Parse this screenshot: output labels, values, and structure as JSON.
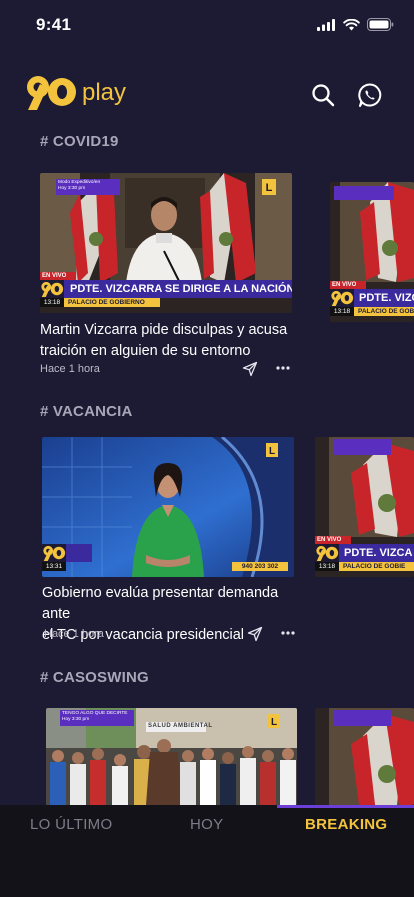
{
  "status_bar": {
    "time": "9:41"
  },
  "header": {
    "logo_word": "play",
    "search_icon": "search-icon",
    "whatsapp_icon": "whatsapp-icon"
  },
  "sections": [
    {
      "tag": "# COVID19",
      "card": {
        "title_line1": "Martin Vizcarra pide disculpas y acusa",
        "title_line2": "traición en alguien de su entorno",
        "time": "Hace 1 hora",
        "overlay": {
          "badge_top_line1": "Modo Expeditivo/en",
          "badge_top_line2": "Hoy 3:30 pm",
          "live": "EN VIVO",
          "headline": "PDTE. VIZCARRA SE DIRIGE A LA NACIÓN",
          "clock": "13:18",
          "location": "PALACIO DE GOBIERNO"
        }
      },
      "peek": {
        "headline": "PDTE. VIZCA",
        "location": "PALACIO DE GOBIE",
        "live": "EN VIVO",
        "clock": "13:18"
      }
    },
    {
      "tag": "# VACANCIA",
      "card": {
        "title_line1": "Gobierno evalúa presentar demanda ante",
        "title_line2": "el TC por vacancia presidencial",
        "time": "Hace 1 hora",
        "overlay": {
          "clock": "13:31",
          "phone": "940 203 302"
        }
      },
      "peek": {
        "headline": "PDTE. VIZCA",
        "location": "PALACIO DE GOBIE",
        "live": "EN VIVO",
        "clock": "13:18"
      }
    },
    {
      "tag": "# CASOSWING",
      "card": {
        "overlay": {
          "badge_top_line1": "TENGO ALGO QUE DECIRTE",
          "badge_top_line2": "Hoy 3:30 pm",
          "sign": "SALUD AMBIENTAL"
        }
      }
    }
  ],
  "bottom_nav": {
    "tabs": [
      {
        "label": "LO ÚLTIMO",
        "active": false
      },
      {
        "label": "HOY",
        "active": false
      },
      {
        "label": "BREAKING",
        "active": true
      }
    ]
  },
  "colors": {
    "background": "#1d1a33",
    "accent": "#f4c33d",
    "indicator": "#6c3fd6",
    "nav_bg": "#121218"
  }
}
